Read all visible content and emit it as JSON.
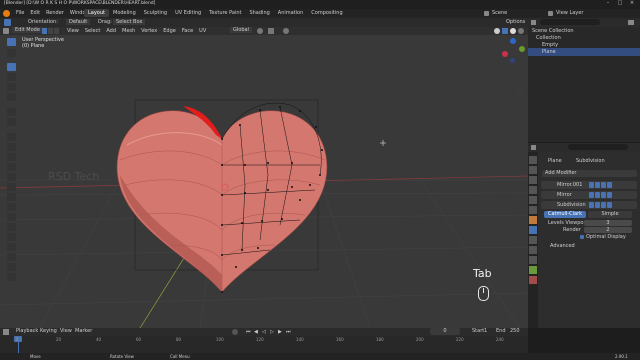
{
  "window": {
    "title": "[Blender] [D:\\W O R K S H O P\\WORKSPACE\\BLENDER\\HEART.blend]"
  },
  "menu": [
    "File",
    "Edit",
    "Render",
    "Window",
    "Help"
  ],
  "workspace_tabs": [
    "Layout",
    "Modeling",
    "Sculpting",
    "UV Editing",
    "Texture Paint",
    "Shading",
    "Animation",
    "Compositing"
  ],
  "active_tab": "Layout",
  "scene": {
    "scene_name": "Scene",
    "view_layer": "View Layer"
  },
  "tool_header": {
    "orientation_label": "Orientation:",
    "orientation_value": "Default",
    "drag_label": "Drag:",
    "drag_value": "Select Box",
    "options_label": "Options"
  },
  "header": {
    "mode": "Edit Mode",
    "view_menu": [
      "View",
      "Select",
      "Add",
      "Mesh",
      "Vertex",
      "Edge",
      "Face",
      "UV"
    ],
    "transform_orientation": "Global"
  },
  "viewport": {
    "view_name": "User Perspective",
    "object_name": "(0) Plane",
    "watermark": "RSD Tech",
    "overlay_key": "Tab",
    "colors": {
      "background": "#393939",
      "heart": "#d87a72",
      "heart_dark": "#a04c48",
      "red_face": "#e31c1c"
    }
  },
  "outliner": {
    "scene_collection": "Scene Collection",
    "collection": "Collection",
    "items": [
      "Empty",
      "Plane"
    ],
    "selected": "Plane"
  },
  "properties": {
    "object": "Plane",
    "modifier_context": "Subdivision",
    "add_modifier": "Add Modifier",
    "modifiers": [
      "Mirror.001",
      "Mirror",
      "Subdivision"
    ],
    "subdivision": {
      "catmull_clark": "Catmull-Clark",
      "simple": "Simple",
      "levels_viewport_label": "Levels Viewport",
      "levels_viewport_value": "3",
      "render_label": "Render",
      "render_value": "2",
      "optimal_display": "Optimal Display",
      "advanced": "Advanced"
    }
  },
  "timeline": {
    "playback": "Playback",
    "keying": "Keying",
    "view": "View",
    "marker": "Marker",
    "current_frame": "0",
    "start_label": "Start",
    "start_value": "1",
    "end_label": "End",
    "end_value": "250",
    "ticks": [
      "0",
      "20",
      "40",
      "60",
      "80",
      "100",
      "120",
      "140",
      "160",
      "180",
      "200",
      "220",
      "240"
    ]
  },
  "statusbar": {
    "left": "Move",
    "middle_a": "Rotate View",
    "middle_b": "Call Menu",
    "version": "2.90.1"
  }
}
